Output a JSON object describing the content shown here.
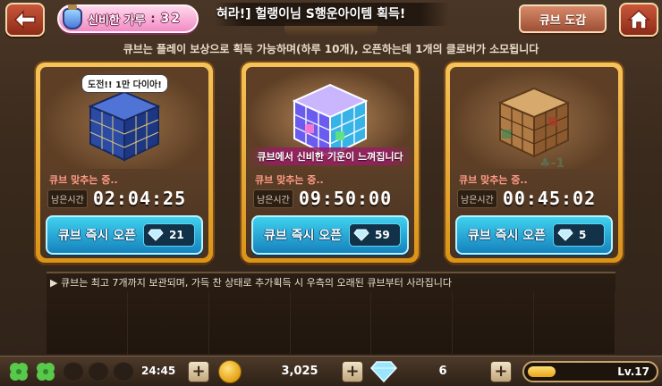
{
  "header": {
    "gauge_label": "신비한 가루",
    "gauge_sep": ":",
    "gauge_value": "32",
    "banner_text": "혀라!] 헐랭이님 S행운아이템 획득!",
    "dict_button": "큐브 도감",
    "back_icon": "back-arrow-icon",
    "home_icon": "home-icon"
  },
  "info_text": "큐브는 플레이 보상으로 획득 가능하며(하루 10개), 오픈하는데 1개의 클로버가 소모됩니다",
  "cards": [
    {
      "bubble": "도전!! 1만 다이아!",
      "caption": "",
      "status": "큐브 맞추는 중..",
      "time_tag": "남은시간",
      "time": "02:04:25",
      "open_label": "큐브 즉시 오픈",
      "cost": "21",
      "cube_color": "#2f4fa8"
    },
    {
      "bubble": "",
      "caption": "큐브에서 신비한 기운이 느껴집니다",
      "status": "큐브 맞추는 중..",
      "time_tag": "남은시간",
      "time": "09:50:00",
      "open_label": "큐브 즉시 오픈",
      "cost": "59",
      "cube_color": "#7a8cff"
    },
    {
      "bubble": "",
      "caption": "",
      "status": "큐브 맞추는 중..",
      "time_tag": "남은시간",
      "time": "00:45:02",
      "open_label": "큐브 즉시 오픈",
      "cost": "5",
      "cube_color": "#b0834e",
      "clover_cost": "-1"
    }
  ],
  "log_text": "▶ 큐브는 최고 7개까지 보관되며, 가득 찬 상태로 추가획득 시 우측의 오래된 큐브부터 사라집니다",
  "footer": {
    "clovers_filled": 2,
    "clovers_total": 5,
    "clover_timer": "24:45",
    "gold": "3,025",
    "gems": "6",
    "level": "Lv.17",
    "level_progress": 0.22
  },
  "colors": {
    "card_frame": "#f6c35a",
    "open_button": "#1582bd",
    "gauge": "#f18bc4"
  }
}
